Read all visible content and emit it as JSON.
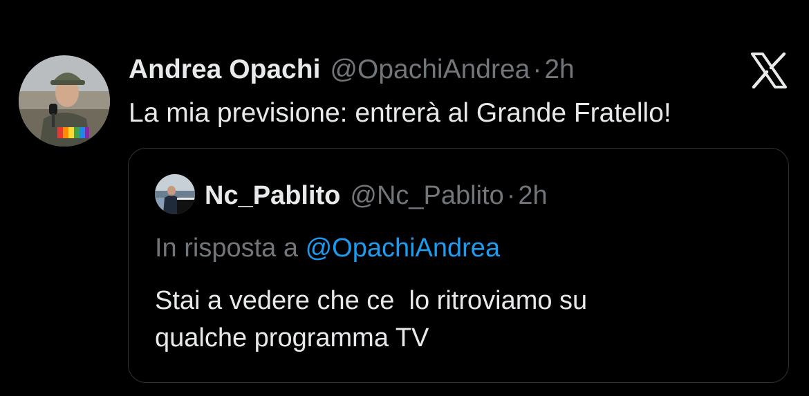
{
  "tweet": {
    "display_name": "Andrea Opachi",
    "handle": "@OpachiAndrea",
    "separator": "·",
    "time": "2h",
    "text": "La mia previsione: entrerà al Grande Fratello!",
    "avatar_icon": "avatar-reporter-helmet",
    "platform_icon": "x-logo-icon"
  },
  "quote": {
    "display_name": "Nc_Pablito",
    "handle": "@Nc_Pablito",
    "separator": "·",
    "time": "2h",
    "reply_prefix": "In risposta a",
    "reply_to": "@OpachiAndrea",
    "text_line1": "Stai a vedere che ce  lo ritroviamo su",
    "text_line2": "qualche programma TV",
    "avatar_icon": "avatar-piano-player"
  },
  "colors": {
    "background": "#000000",
    "primary_text": "#e7e9ea",
    "secondary_text": "#71767b",
    "link": "#1d9bf0",
    "border": "#2f3336"
  }
}
